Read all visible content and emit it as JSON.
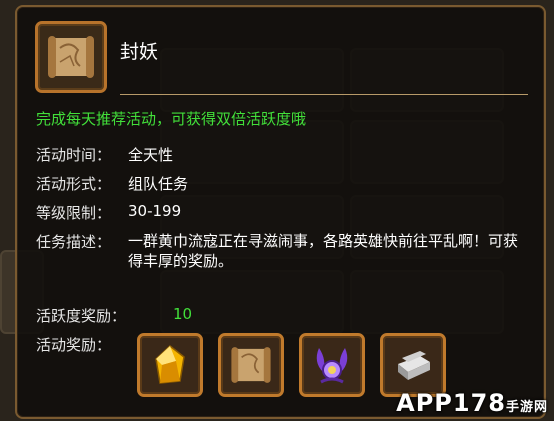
{
  "item": {
    "title": "封妖",
    "highlight": "完成每天推荐活动，可获得双倍活跃度哦"
  },
  "details": {
    "time_label": "活动时间：",
    "time_value": "全天性",
    "form_label": "活动形式：",
    "form_value": "组队任务",
    "level_label": "等级限制：",
    "level_value": "30-199",
    "desc_label": "任务描述：",
    "desc_value": "一群黄巾流寇正在寻滋闹事，各路英雄快前往平乱啊！可获得丰厚的奖励。",
    "vitality_label": "活跃度奖励：",
    "vitality_value": "10",
    "reward_label": "活动奖励："
  },
  "rewards": [
    {
      "name": "gold-crystal-icon"
    },
    {
      "name": "scroll-icon"
    },
    {
      "name": "purple-orb-icon"
    },
    {
      "name": "silver-ingot-icon"
    }
  ],
  "watermark": {
    "main": "APP178",
    "sub": "手游网"
  },
  "colors": {
    "highlight": "#42e03a",
    "frame": "#c07a2c",
    "title": "#ffffff"
  }
}
